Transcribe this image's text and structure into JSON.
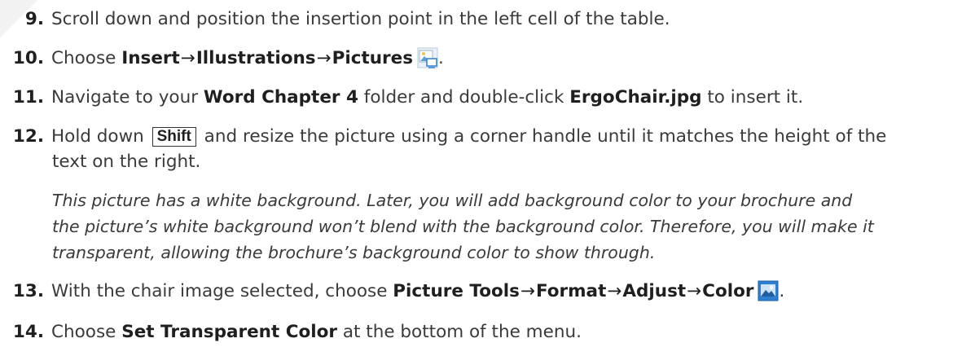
{
  "steps": {
    "s9": {
      "number": "9.",
      "text": "Scroll down and position the insertion point in the left cell of the table."
    },
    "s10": {
      "number": "10.",
      "pre": "Choose ",
      "k1": "Insert",
      "k2": "Illustrations",
      "k3": "Pictures",
      "arrow": "→",
      "icon": "pictures-icon"
    },
    "s11": {
      "number": "11.",
      "pre": "Navigate to your ",
      "k1": "Word Chapter 4",
      "mid": " folder and double-click ",
      "k2": "ErgoChair.jpg",
      "post": " to insert it."
    },
    "s12": {
      "number": "12.",
      "pre": "Hold down ",
      "key": "Shift",
      "post": " and resize the picture using a corner handle until it matches the height of the",
      "cont": "text on the right."
    },
    "note": {
      "line1": "This picture has a white background. Later, you will add background color to your brochure and",
      "line2": "the picture’s white background won’t blend with the background color. Therefore, you will make it",
      "line3": "transparent, allowing the brochure’s background color to show through."
    },
    "s13": {
      "number": "13.",
      "pre": "With the chair image selected, choose ",
      "k1": "Picture Tools",
      "k2": "Format",
      "k3": "Adjust",
      "k4": "Color",
      "arrow": "→",
      "icon": "color-icon"
    },
    "s14": {
      "number": "14.",
      "pre": "Choose ",
      "k1": "Set Transparent Color",
      "post": " at the bottom of the menu."
    }
  },
  "colors": {
    "text": "#3a3a3a",
    "bold": "#1f1f1f",
    "icon_blue": "#2e7fd1"
  }
}
